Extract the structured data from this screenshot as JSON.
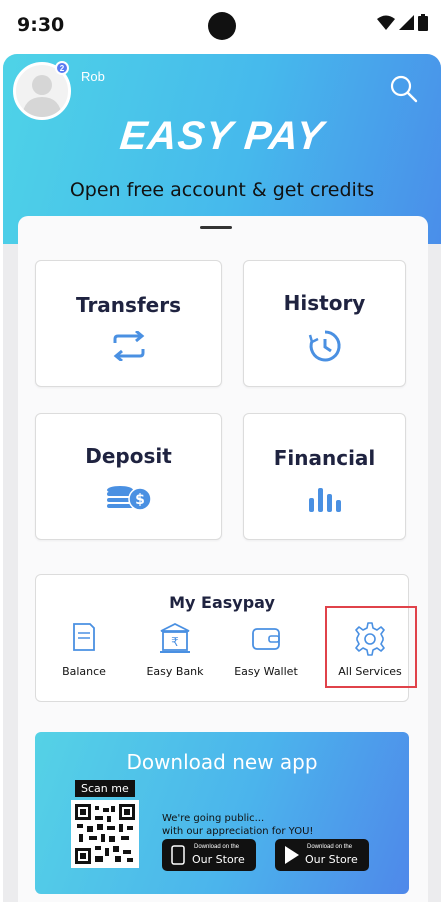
{
  "status_bar": {
    "time": "9:30"
  },
  "header": {
    "user_name": "Rob",
    "avatar_badge": "2",
    "brand": "EASY PAY",
    "tagline": "Open free account & get credits"
  },
  "tiles": [
    {
      "label": "Transfers",
      "icon": "transfer-arrows-icon"
    },
    {
      "label": "History",
      "icon": "history-clock-icon"
    },
    {
      "label": "Deposit",
      "icon": "coins-dollar-icon"
    },
    {
      "label": "Financial",
      "icon": "bar-chart-icon"
    }
  ],
  "my_easypay": {
    "title": "My Easypay",
    "services": [
      {
        "label": "Balance",
        "icon": "document-icon"
      },
      {
        "label": "Easy Bank",
        "icon": "bank-rupee-icon"
      },
      {
        "label": "Easy Wallet",
        "icon": "wallet-icon"
      },
      {
        "label": "All Services",
        "icon": "gear-icon"
      }
    ]
  },
  "banner": {
    "title": "Download new app",
    "scan_label": "Scan me",
    "line1": "We're going public...",
    "line2": "with our appreciation for YOU!",
    "store_buttons": [
      {
        "small": "Download on the",
        "big": "Our Store",
        "icon": "phone-icon"
      },
      {
        "small": "Download on the",
        "big": "Our Store",
        "icon": "play-icon"
      }
    ]
  },
  "colors": {
    "accent_blue": "#4a90e2",
    "header_gradient_start": "#4ed3e7",
    "header_gradient_end": "#4a8eea",
    "highlight_red": "#e0424a"
  }
}
